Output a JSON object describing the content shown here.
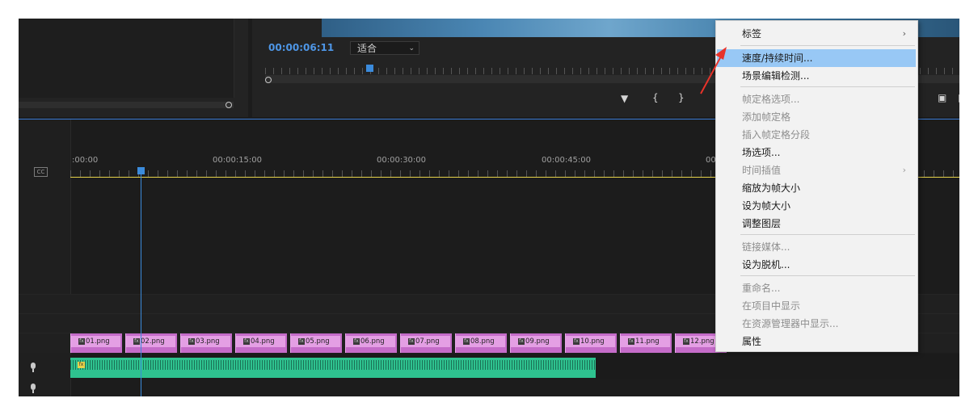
{
  "program_monitor": {
    "timecode": "00:00:06:11",
    "zoom_select": "适合"
  },
  "timeline": {
    "ruler": {
      "t0": ":00:00",
      "t1": "00:00:15:00",
      "t2": "00:00:30:00",
      "t3": "00:00:45:00",
      "t4": "00"
    },
    "clips": [
      "01.png",
      "02.png",
      "03.png",
      "04.png",
      "05.png",
      "06.png",
      "07.png",
      "08.png",
      "09.png",
      "10.png",
      "11.png",
      "12.png"
    ],
    "fx_badge": "fx",
    "cc_label": "CC"
  },
  "context_menu": {
    "items": [
      {
        "label": "标签",
        "disabled": false,
        "submenu": true
      },
      {
        "label": "速度/持续时间...",
        "disabled": false,
        "highlighted": true
      },
      {
        "label": "场景编辑检测...",
        "disabled": false
      },
      {
        "label": "帧定格选项...",
        "disabled": true
      },
      {
        "label": "添加帧定格",
        "disabled": true
      },
      {
        "label": "插入帧定格分段",
        "disabled": true
      },
      {
        "label": "场选项...",
        "disabled": false
      },
      {
        "label": "时间插值",
        "disabled": true,
        "submenu": true
      },
      {
        "label": "缩放为帧大小",
        "disabled": false
      },
      {
        "label": "设为帧大小",
        "disabled": false
      },
      {
        "label": "调整图层",
        "disabled": false
      },
      {
        "label": "链接媒体...",
        "disabled": true
      },
      {
        "label": "设为脱机...",
        "disabled": false
      },
      {
        "label": "重命名...",
        "disabled": true
      },
      {
        "label": "在项目中显示",
        "disabled": true
      },
      {
        "label": "在资源管理器中显示...",
        "disabled": true
      },
      {
        "label": "属性",
        "disabled": false
      }
    ],
    "submenu_glyph": "›"
  },
  "colors": {
    "accent_blue": "#3b8bdc",
    "clip_pink": "#c56cc9",
    "audio_green": "#2ec28f",
    "menu_highlight": "#98c8f5",
    "annotation_red": "#e8332a"
  }
}
